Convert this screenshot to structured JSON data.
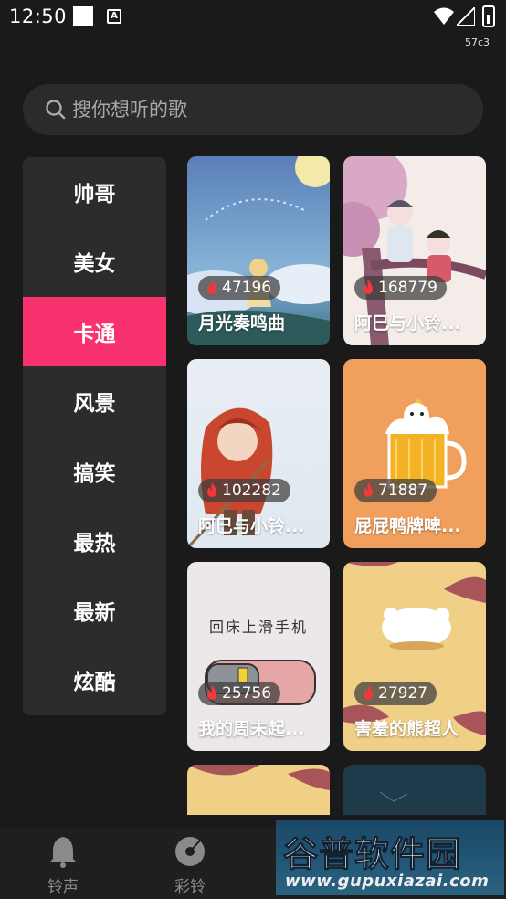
{
  "status_bar": {
    "time": "12:50",
    "build_tag": "57c3"
  },
  "search": {
    "placeholder": "搜你想听的歌"
  },
  "categories": [
    {
      "label": "帅哥",
      "active": false
    },
    {
      "label": "美女",
      "active": false
    },
    {
      "label": "卡通",
      "active": true
    },
    {
      "label": "风景",
      "active": false
    },
    {
      "label": "搞笑",
      "active": false
    },
    {
      "label": "最热",
      "active": false
    },
    {
      "label": "最新",
      "active": false
    },
    {
      "label": "炫酷",
      "active": false
    }
  ],
  "cards": [
    {
      "count": "47196",
      "title": "月光奏鸣曲",
      "art": "moonlight-sky-illustration"
    },
    {
      "count": "168779",
      "title": "阿巳与小铃...",
      "art": "tree-characters-illustration"
    },
    {
      "count": "102282",
      "title": "阿巳与小铃...",
      "art": "red-hood-girl-illustration"
    },
    {
      "count": "71887",
      "title": "屁屁鸭牌啤...",
      "art": "duck-beer-mug-illustration"
    },
    {
      "count": "25756",
      "title": "我的周末起...",
      "art": "bed-phone-illustration"
    },
    {
      "count": "27927",
      "title": "害羞的熊超人",
      "art": "shy-bear-illustration"
    }
  ],
  "card_art_text": {
    "bed_phone_caption": "回床上滑手机"
  },
  "bottom_nav": [
    {
      "label": "铃声",
      "icon": "bell-icon"
    },
    {
      "label": "彩铃",
      "icon": "disc-icon"
    }
  ],
  "watermark": {
    "brand": "谷普软件园",
    "url": "www.gupuxiazai.com"
  },
  "colors": {
    "background": "#1a1a1a",
    "panel": "#2c2c2c",
    "accent": "#f8326e"
  }
}
